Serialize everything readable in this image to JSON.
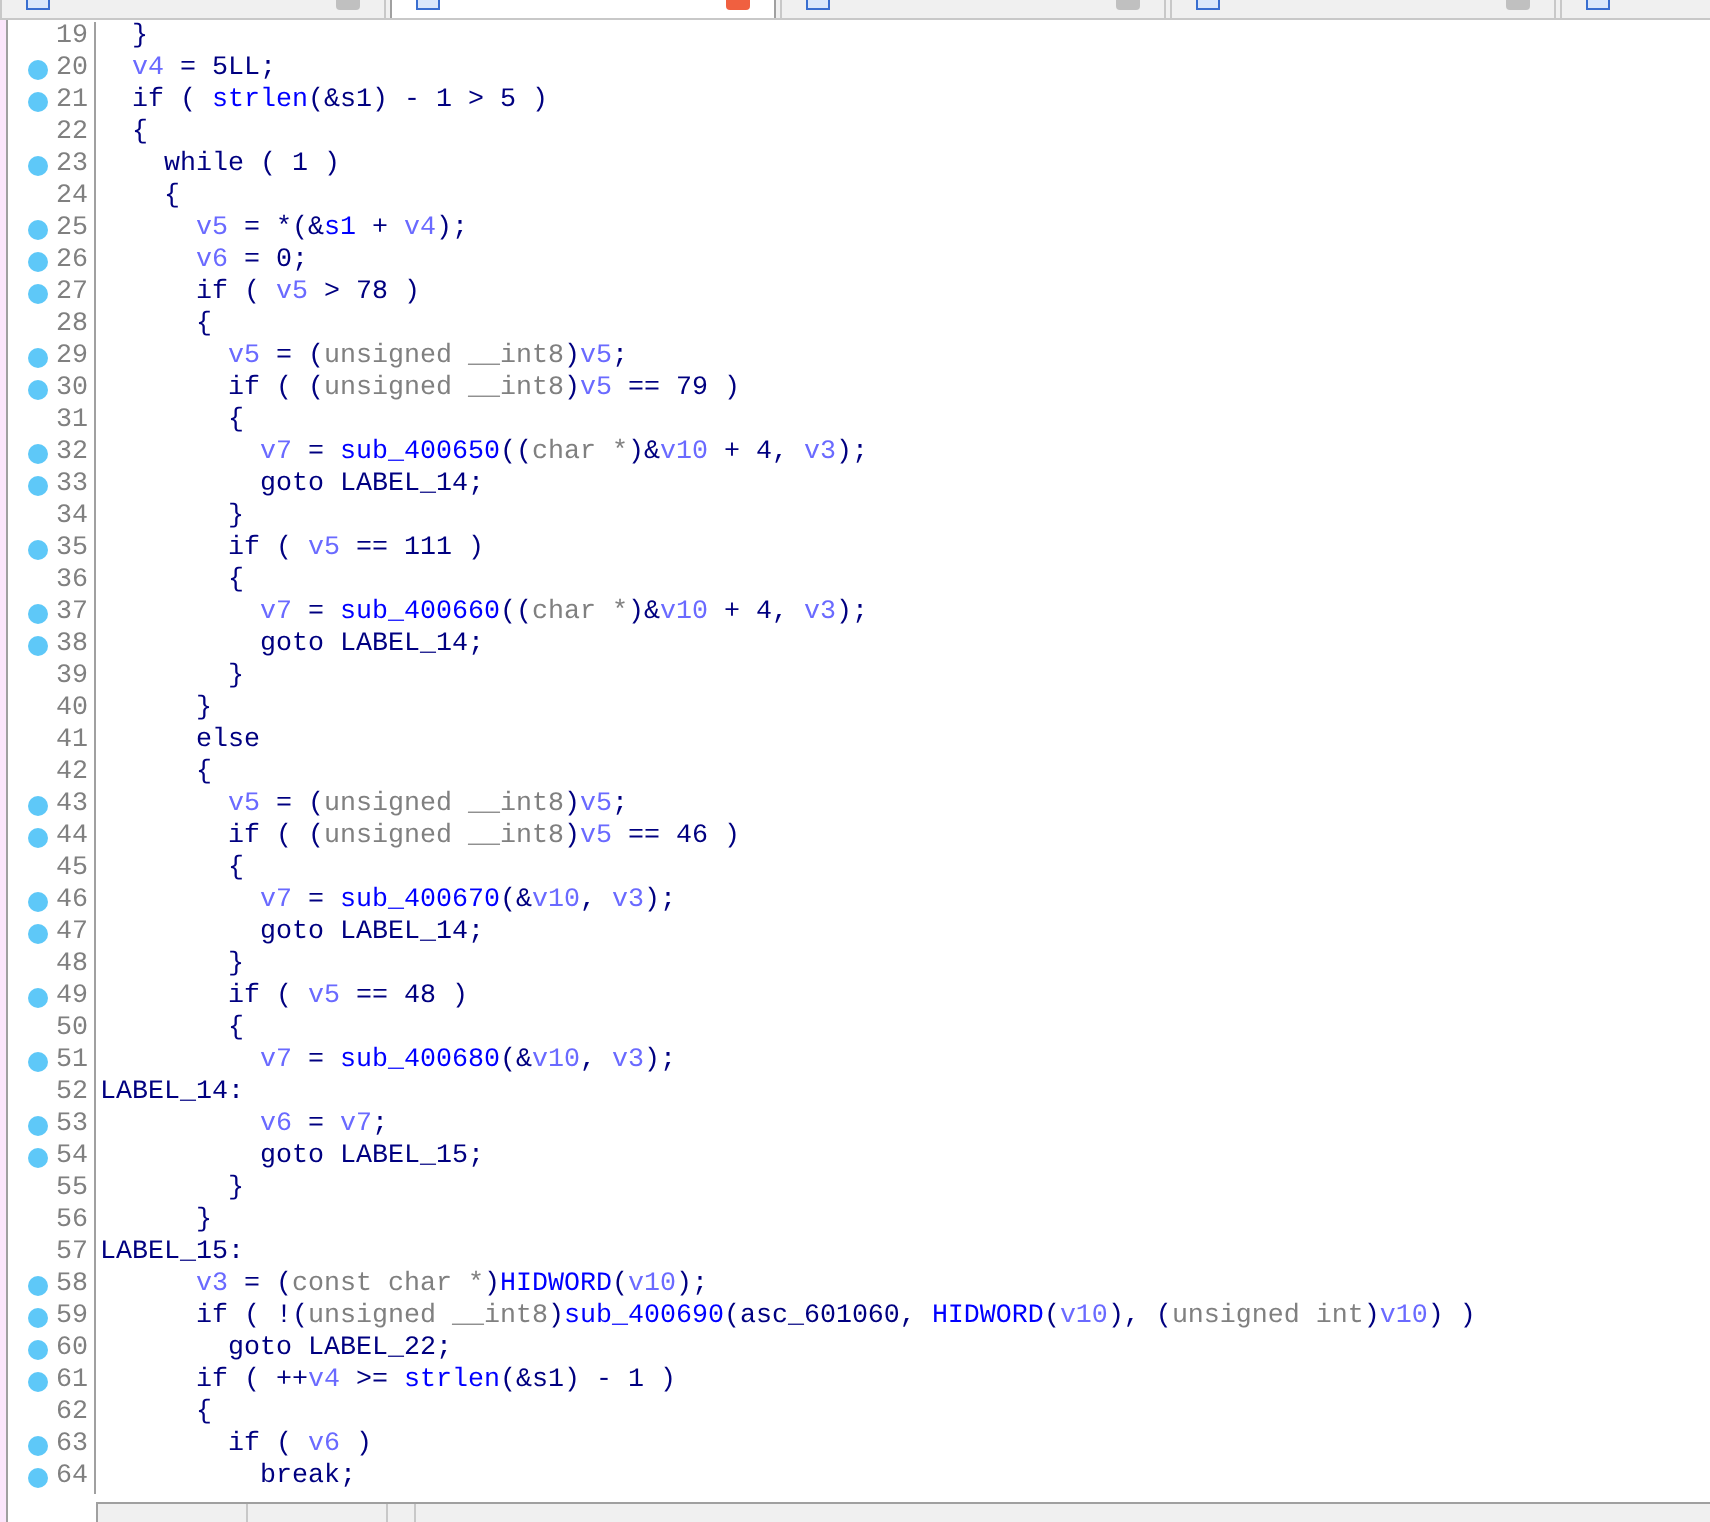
{
  "tabs": [
    {
      "selected": false
    },
    {
      "selected": true
    },
    {
      "selected": false
    },
    {
      "selected": false
    },
    {
      "selected": false
    }
  ],
  "lines": [
    {
      "number": "19",
      "dot": false,
      "code": [
        {
          "text": "  }",
          "kind": "plain"
        }
      ]
    },
    {
      "number": "20",
      "dot": true,
      "code": [
        {
          "text": "  v4",
          "kind": "var"
        },
        {
          "text": " = 5LL;",
          "kind": "plain"
        }
      ]
    },
    {
      "number": "21",
      "dot": true,
      "code": [
        {
          "text": "  if ( ",
          "kind": "plain"
        },
        {
          "text": "strlen",
          "kind": "name"
        },
        {
          "text": "(&s1) - 1 > 5 )",
          "kind": "plain"
        }
      ]
    },
    {
      "number": "22",
      "dot": false,
      "code": [
        {
          "text": "  {",
          "kind": "plain"
        }
      ]
    },
    {
      "number": "23",
      "dot": true,
      "code": [
        {
          "text": "    while ( 1 )",
          "kind": "plain"
        }
      ]
    },
    {
      "number": "24",
      "dot": false,
      "code": [
        {
          "text": "    {",
          "kind": "plain"
        }
      ]
    },
    {
      "number": "25",
      "dot": true,
      "code": [
        {
          "text": "      v5",
          "kind": "var"
        },
        {
          "text": " = *(&",
          "kind": "plain"
        },
        {
          "text": "s1",
          "kind": "name"
        },
        {
          "text": " + ",
          "kind": "plain"
        },
        {
          "text": "v4",
          "kind": "var"
        },
        {
          "text": ");",
          "kind": "plain"
        }
      ]
    },
    {
      "number": "26",
      "dot": true,
      "code": [
        {
          "text": "      v6",
          "kind": "var"
        },
        {
          "text": " = 0;",
          "kind": "plain"
        }
      ]
    },
    {
      "number": "27",
      "dot": true,
      "code": [
        {
          "text": "      if ( ",
          "kind": "plain"
        },
        {
          "text": "v5",
          "kind": "var"
        },
        {
          "text": " > 78 )",
          "kind": "plain"
        }
      ]
    },
    {
      "number": "28",
      "dot": false,
      "code": [
        {
          "text": "      {",
          "kind": "plain"
        }
      ]
    },
    {
      "number": "29",
      "dot": true,
      "code": [
        {
          "text": "        v5",
          "kind": "var"
        },
        {
          "text": " = (",
          "kind": "plain"
        },
        {
          "text": "unsigned __int8",
          "kind": "type"
        },
        {
          "text": ")",
          "kind": "plain"
        },
        {
          "text": "v5",
          "kind": "var"
        },
        {
          "text": ";",
          "kind": "plain"
        }
      ]
    },
    {
      "number": "30",
      "dot": true,
      "code": [
        {
          "text": "        if ( (",
          "kind": "plain"
        },
        {
          "text": "unsigned __int8",
          "kind": "type"
        },
        {
          "text": ")",
          "kind": "plain"
        },
        {
          "text": "v5",
          "kind": "var"
        },
        {
          "text": " == 79 )",
          "kind": "plain"
        }
      ]
    },
    {
      "number": "31",
      "dot": false,
      "code": [
        {
          "text": "        {",
          "kind": "plain"
        }
      ]
    },
    {
      "number": "32",
      "dot": true,
      "code": [
        {
          "text": "          v7",
          "kind": "var"
        },
        {
          "text": " = ",
          "kind": "plain"
        },
        {
          "text": "sub_400650",
          "kind": "name"
        },
        {
          "text": "((",
          "kind": "plain"
        },
        {
          "text": "char *",
          "kind": "type"
        },
        {
          "text": ")&",
          "kind": "plain"
        },
        {
          "text": "v10",
          "kind": "var"
        },
        {
          "text": " + 4, ",
          "kind": "plain"
        },
        {
          "text": "v3",
          "kind": "var"
        },
        {
          "text": ");",
          "kind": "plain"
        }
      ]
    },
    {
      "number": "33",
      "dot": true,
      "code": [
        {
          "text": "          goto LABEL_14;",
          "kind": "plain"
        }
      ]
    },
    {
      "number": "34",
      "dot": false,
      "code": [
        {
          "text": "        }",
          "kind": "plain"
        }
      ]
    },
    {
      "number": "35",
      "dot": true,
      "code": [
        {
          "text": "        if ( ",
          "kind": "plain"
        },
        {
          "text": "v5",
          "kind": "var"
        },
        {
          "text": " == 111 )",
          "kind": "plain"
        }
      ]
    },
    {
      "number": "36",
      "dot": false,
      "code": [
        {
          "text": "        {",
          "kind": "plain"
        }
      ]
    },
    {
      "number": "37",
      "dot": true,
      "code": [
        {
          "text": "          v7",
          "kind": "var"
        },
        {
          "text": " = ",
          "kind": "plain"
        },
        {
          "text": "sub_400660",
          "kind": "name"
        },
        {
          "text": "((",
          "kind": "plain"
        },
        {
          "text": "char *",
          "kind": "type"
        },
        {
          "text": ")&",
          "kind": "plain"
        },
        {
          "text": "v10",
          "kind": "var"
        },
        {
          "text": " + 4, ",
          "kind": "plain"
        },
        {
          "text": "v3",
          "kind": "var"
        },
        {
          "text": ");",
          "kind": "plain"
        }
      ]
    },
    {
      "number": "38",
      "dot": true,
      "code": [
        {
          "text": "          goto LABEL_14;",
          "kind": "plain"
        }
      ]
    },
    {
      "number": "39",
      "dot": false,
      "code": [
        {
          "text": "        }",
          "kind": "plain"
        }
      ]
    },
    {
      "number": "40",
      "dot": false,
      "code": [
        {
          "text": "      }",
          "kind": "plain"
        }
      ]
    },
    {
      "number": "41",
      "dot": false,
      "code": [
        {
          "text": "      else",
          "kind": "plain"
        }
      ]
    },
    {
      "number": "42",
      "dot": false,
      "code": [
        {
          "text": "      {",
          "kind": "plain"
        }
      ]
    },
    {
      "number": "43",
      "dot": true,
      "code": [
        {
          "text": "        v5",
          "kind": "var"
        },
        {
          "text": " = (",
          "kind": "plain"
        },
        {
          "text": "unsigned __int8",
          "kind": "type"
        },
        {
          "text": ")",
          "kind": "plain"
        },
        {
          "text": "v5",
          "kind": "var"
        },
        {
          "text": ";",
          "kind": "plain"
        }
      ]
    },
    {
      "number": "44",
      "dot": true,
      "code": [
        {
          "text": "        if ( (",
          "kind": "plain"
        },
        {
          "text": "unsigned __int8",
          "kind": "type"
        },
        {
          "text": ")",
          "kind": "plain"
        },
        {
          "text": "v5",
          "kind": "var"
        },
        {
          "text": " == 46 )",
          "kind": "plain"
        }
      ]
    },
    {
      "number": "45",
      "dot": false,
      "code": [
        {
          "text": "        {",
          "kind": "plain"
        }
      ]
    },
    {
      "number": "46",
      "dot": true,
      "code": [
        {
          "text": "          v7",
          "kind": "var"
        },
        {
          "text": " = ",
          "kind": "plain"
        },
        {
          "text": "sub_400670",
          "kind": "name"
        },
        {
          "text": "(&",
          "kind": "plain"
        },
        {
          "text": "v10",
          "kind": "var"
        },
        {
          "text": ", ",
          "kind": "plain"
        },
        {
          "text": "v3",
          "kind": "var"
        },
        {
          "text": ");",
          "kind": "plain"
        }
      ]
    },
    {
      "number": "47",
      "dot": true,
      "code": [
        {
          "text": "          goto LABEL_14;",
          "kind": "plain"
        }
      ]
    },
    {
      "number": "48",
      "dot": false,
      "code": [
        {
          "text": "        }",
          "kind": "plain"
        }
      ]
    },
    {
      "number": "49",
      "dot": true,
      "code": [
        {
          "text": "        if ( ",
          "kind": "plain"
        },
        {
          "text": "v5",
          "kind": "var"
        },
        {
          "text": " == 48 )",
          "kind": "plain"
        }
      ]
    },
    {
      "number": "50",
      "dot": false,
      "code": [
        {
          "text": "        {",
          "kind": "plain"
        }
      ]
    },
    {
      "number": "51",
      "dot": true,
      "code": [
        {
          "text": "          v7",
          "kind": "var"
        },
        {
          "text": " = ",
          "kind": "plain"
        },
        {
          "text": "sub_400680",
          "kind": "name"
        },
        {
          "text": "(&",
          "kind": "plain"
        },
        {
          "text": "v10",
          "kind": "var"
        },
        {
          "text": ", ",
          "kind": "plain"
        },
        {
          "text": "v3",
          "kind": "var"
        },
        {
          "text": ");",
          "kind": "plain"
        }
      ]
    },
    {
      "number": "52",
      "dot": false,
      "code": [
        {
          "text": "LABEL_14:",
          "kind": "plain"
        }
      ]
    },
    {
      "number": "53",
      "dot": true,
      "code": [
        {
          "text": "          v6",
          "kind": "var"
        },
        {
          "text": " = ",
          "kind": "plain"
        },
        {
          "text": "v7",
          "kind": "var"
        },
        {
          "text": ";",
          "kind": "plain"
        }
      ]
    },
    {
      "number": "54",
      "dot": true,
      "code": [
        {
          "text": "          goto LABEL_15;",
          "kind": "plain"
        }
      ]
    },
    {
      "number": "55",
      "dot": false,
      "code": [
        {
          "text": "        }",
          "kind": "plain"
        }
      ]
    },
    {
      "number": "56",
      "dot": false,
      "code": [
        {
          "text": "      }",
          "kind": "plain"
        }
      ]
    },
    {
      "number": "57",
      "dot": false,
      "code": [
        {
          "text": "LABEL_15:",
          "kind": "plain"
        }
      ]
    },
    {
      "number": "58",
      "dot": true,
      "code": [
        {
          "text": "      v3",
          "kind": "var"
        },
        {
          "text": " = (",
          "kind": "plain"
        },
        {
          "text": "const char *",
          "kind": "type"
        },
        {
          "text": ")",
          "kind": "plain"
        },
        {
          "text": "HIDWORD",
          "kind": "name"
        },
        {
          "text": "(",
          "kind": "plain"
        },
        {
          "text": "v10",
          "kind": "var"
        },
        {
          "text": ");",
          "kind": "plain"
        }
      ]
    },
    {
      "number": "59",
      "dot": true,
      "code": [
        {
          "text": "      if ( !(",
          "kind": "plain"
        },
        {
          "text": "unsigned __int8",
          "kind": "type"
        },
        {
          "text": ")",
          "kind": "plain"
        },
        {
          "text": "sub_400690",
          "kind": "name"
        },
        {
          "text": "(asc_601060, ",
          "kind": "plain"
        },
        {
          "text": "HIDWORD",
          "kind": "name"
        },
        {
          "text": "(",
          "kind": "plain"
        },
        {
          "text": "v10",
          "kind": "var"
        },
        {
          "text": "), (",
          "kind": "plain"
        },
        {
          "text": "unsigned int",
          "kind": "type"
        },
        {
          "text": ")",
          "kind": "plain"
        },
        {
          "text": "v10",
          "kind": "var"
        },
        {
          "text": ") )",
          "kind": "plain"
        }
      ]
    },
    {
      "number": "60",
      "dot": true,
      "code": [
        {
          "text": "        goto LABEL_22;",
          "kind": "plain"
        }
      ]
    },
    {
      "number": "61",
      "dot": true,
      "code": [
        {
          "text": "      if ( ++",
          "kind": "plain"
        },
        {
          "text": "v4",
          "kind": "var"
        },
        {
          "text": " >= ",
          "kind": "plain"
        },
        {
          "text": "strlen",
          "kind": "name"
        },
        {
          "text": "(&s1) - 1 )",
          "kind": "plain"
        }
      ]
    },
    {
      "number": "62",
      "dot": false,
      "code": [
        {
          "text": "      {",
          "kind": "plain"
        }
      ]
    },
    {
      "number": "63",
      "dot": true,
      "code": [
        {
          "text": "        if ( ",
          "kind": "plain"
        },
        {
          "text": "v6",
          "kind": "var"
        },
        {
          "text": " )",
          "kind": "plain"
        }
      ]
    },
    {
      "number": "64",
      "dot": true,
      "code": [
        {
          "text": "          break;",
          "kind": "plain"
        }
      ]
    }
  ]
}
